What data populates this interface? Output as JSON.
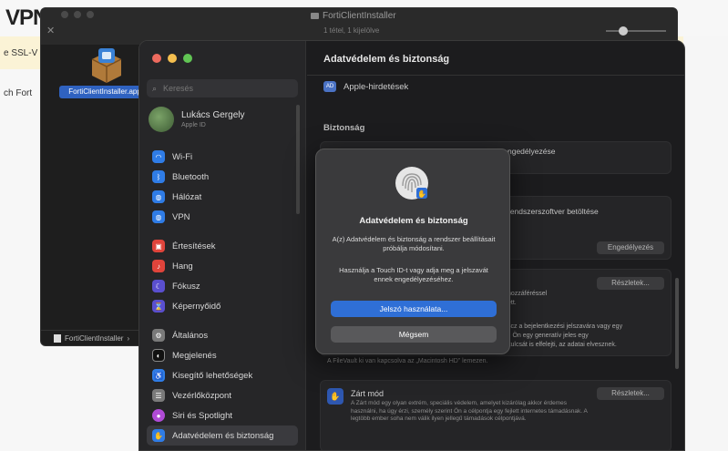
{
  "background": {
    "title": "VPN",
    "banner_text": "e SSL-V",
    "side_text": "ch Fort"
  },
  "finder": {
    "title": "FortiClientInstaller",
    "subtitle": "1 tétel, 1 kijelölve",
    "file_label": "FortiClientInstaller.app",
    "path_label": "FortiClientInstaller",
    "path_sep": "›"
  },
  "settings": {
    "search_placeholder": "Keresés",
    "account": {
      "name": "Lukács Gergely",
      "sub": "Apple ID"
    },
    "sidebar_items": [
      {
        "label": "Wi-Fi",
        "icon": "wifi-icon",
        "color": "#2f7ce6"
      },
      {
        "label": "Bluetooth",
        "icon": "bluetooth-icon",
        "color": "#2f7ce6"
      },
      {
        "label": "Hálózat",
        "icon": "network-icon",
        "color": "#2f7ce6"
      },
      {
        "label": "VPN",
        "icon": "vpn-icon",
        "color": "#2f7ce6"
      },
      {
        "label": "Értesítések",
        "icon": "notifications-icon",
        "color": "#e0443b"
      },
      {
        "label": "Hang",
        "icon": "sound-icon",
        "color": "#e0443b"
      },
      {
        "label": "Fókusz",
        "icon": "focus-icon",
        "color": "#5a4fcf"
      },
      {
        "label": "Képernyőidő",
        "icon": "screen-time-icon",
        "color": "#5a4fcf"
      },
      {
        "label": "Általános",
        "icon": "general-icon",
        "color": "#7a7a7a"
      },
      {
        "label": "Megjelenés",
        "icon": "appearance-icon",
        "color": "#111111"
      },
      {
        "label": "Kisegítő lehetőségek",
        "icon": "accessibility-icon",
        "color": "#2f7ce6"
      },
      {
        "label": "Vezérlőközpont",
        "icon": "control-center-icon",
        "color": "#7a7a7a"
      },
      {
        "label": "Siri és Spotlight",
        "icon": "siri-icon",
        "color": "#b04bd6"
      },
      {
        "label": "Adatvédelem és biztonság",
        "icon": "privacy-icon",
        "color": "#2f7ce6"
      }
    ],
    "main": {
      "title": "Adatvédelem és biztonság",
      "apple_ads": "Apple-hirdetések",
      "security_label": "Biztonság",
      "enable_text": "ngedélyezése",
      "system_sw_text": "rendszerszoftver betöltése",
      "enable_button": "Engedélyezés",
      "details_button": "Részletek...",
      "short_text": "hozzáféréssel",
      "short_text2": "ett.",
      "long_text1": "scz a bejelentkezési jelszavára vagy egy",
      "long_text2": "l. Ön egy generatív jeles egy",
      "long_text3": "kulcsát is elfelejti, az adatai elvesznek.",
      "filevault_text": "A FileVault ki van kapcsolva az „Macintosh HD” lemezen.",
      "lockdown_title": "Zárt mód",
      "lockdown_desc": "A Zárt mód egy olyan extrém, speciális védelem, amelyet kizárólag akkor érdemes használni, ha úgy érzi, személy szerint Ön a célpontja egy fejlett internetes támadásnak. A legtöbb ember soha nem válik ilyen jellegű támadások célpontjává."
    }
  },
  "dialog": {
    "title": "Adatvédelem és biztonság",
    "message": "A(z) Adatvédelem és biztonság a rendszer beállításait próbálja módosítani.",
    "message2": "Használja a Touch ID-t vagy adja meg a jelszavát ennek engedélyezéséhez.",
    "use_password": "Jelszó használata...",
    "cancel": "Mégsem"
  }
}
